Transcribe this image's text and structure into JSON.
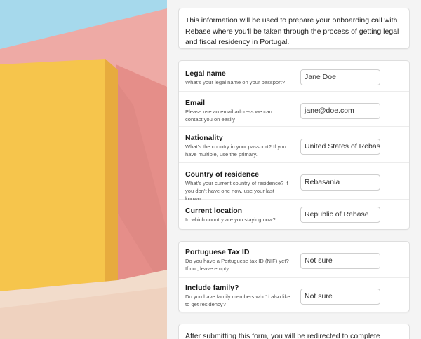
{
  "intro": {
    "text": "This information will be used to prepare your onboarding call with Rebase where you'll be taken through the process of getting legal and fiscal residency in Portugal."
  },
  "fields": [
    {
      "label": "Legal name",
      "help": "What's your legal name on your passport?",
      "value": "Jane Doe"
    },
    {
      "label": "Email",
      "help": "Please use an email address we can contact you on easily",
      "value": "jane@doe.com"
    },
    {
      "label": "Nationality",
      "help": "What's the country in your passport? If you have multiple, use the primary.",
      "value": "United States of Rebase"
    },
    {
      "label": "Country of residence",
      "help": "What's your current country of residence? If you don't have one now, use your last known.",
      "value": "Rebasania"
    },
    {
      "label": "Current location",
      "help": "In which country are you staying now?",
      "value": "Republic of Rebase"
    }
  ],
  "extra_fields": [
    {
      "label": "Portuguese Tax ID",
      "help": "Do you have a Portuguese tax ID (NIF) yet? If not, leave empty.",
      "value": "Not sure"
    },
    {
      "label": "Include family?",
      "help": "Do you have family members who'd also like to get residency?",
      "value": "Not sure"
    }
  ],
  "footer_note": {
    "text": "After submitting this form, you will be redirected to complete payment"
  },
  "colors": {
    "sky": "#9fd5ea",
    "pink_wall": "#eea7a2",
    "yellow_wall": "#f7c14a",
    "floor": "#f1dcc9"
  }
}
